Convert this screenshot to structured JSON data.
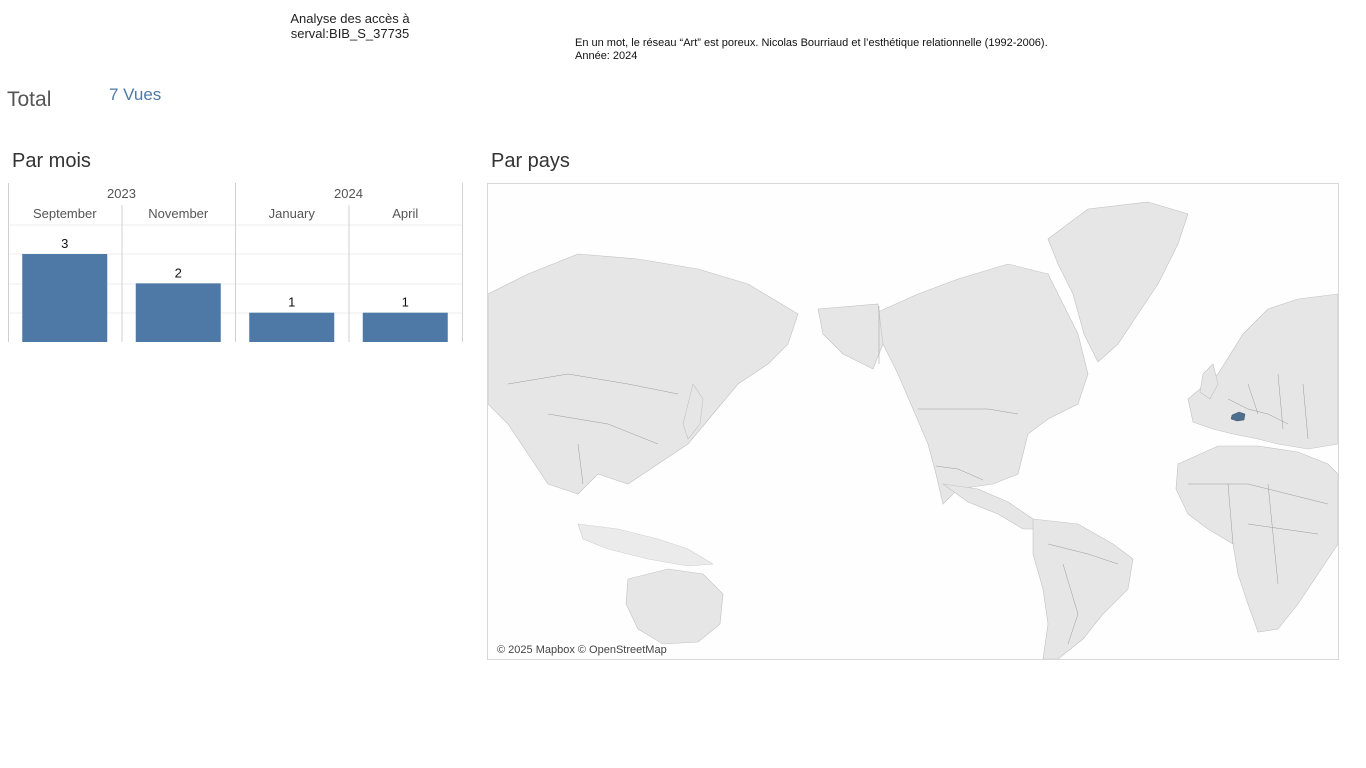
{
  "header": {
    "title_line1": "Analyse des accès à",
    "title_line2": "serval:BIB_S_37735"
  },
  "doc": {
    "title": "En un mot, le réseau “Art” est poreux. Nicolas Bourriaud et l’esthétique relationnelle (1992-2006).",
    "year_line": "Année: 2024"
  },
  "total": {
    "label": "Total",
    "value": "7 Vues"
  },
  "sections": {
    "par_mois": "Par mois",
    "par_pays": "Par pays"
  },
  "chart_data": {
    "type": "bar",
    "title": "Par mois",
    "years": [
      {
        "label": "2023",
        "span": 2
      },
      {
        "label": "2024",
        "span": 2
      }
    ],
    "categories": [
      "September",
      "November",
      "January",
      "April"
    ],
    "values": [
      3,
      2,
      1,
      1
    ],
    "ylim": [
      0,
      3
    ],
    "bar_color": "#4e79a7",
    "grid": true
  },
  "map": {
    "highlight_country": "Switzerland",
    "highlight_color": "#4e6e8e",
    "attribution": "© 2025 Mapbox © OpenStreetMap"
  }
}
